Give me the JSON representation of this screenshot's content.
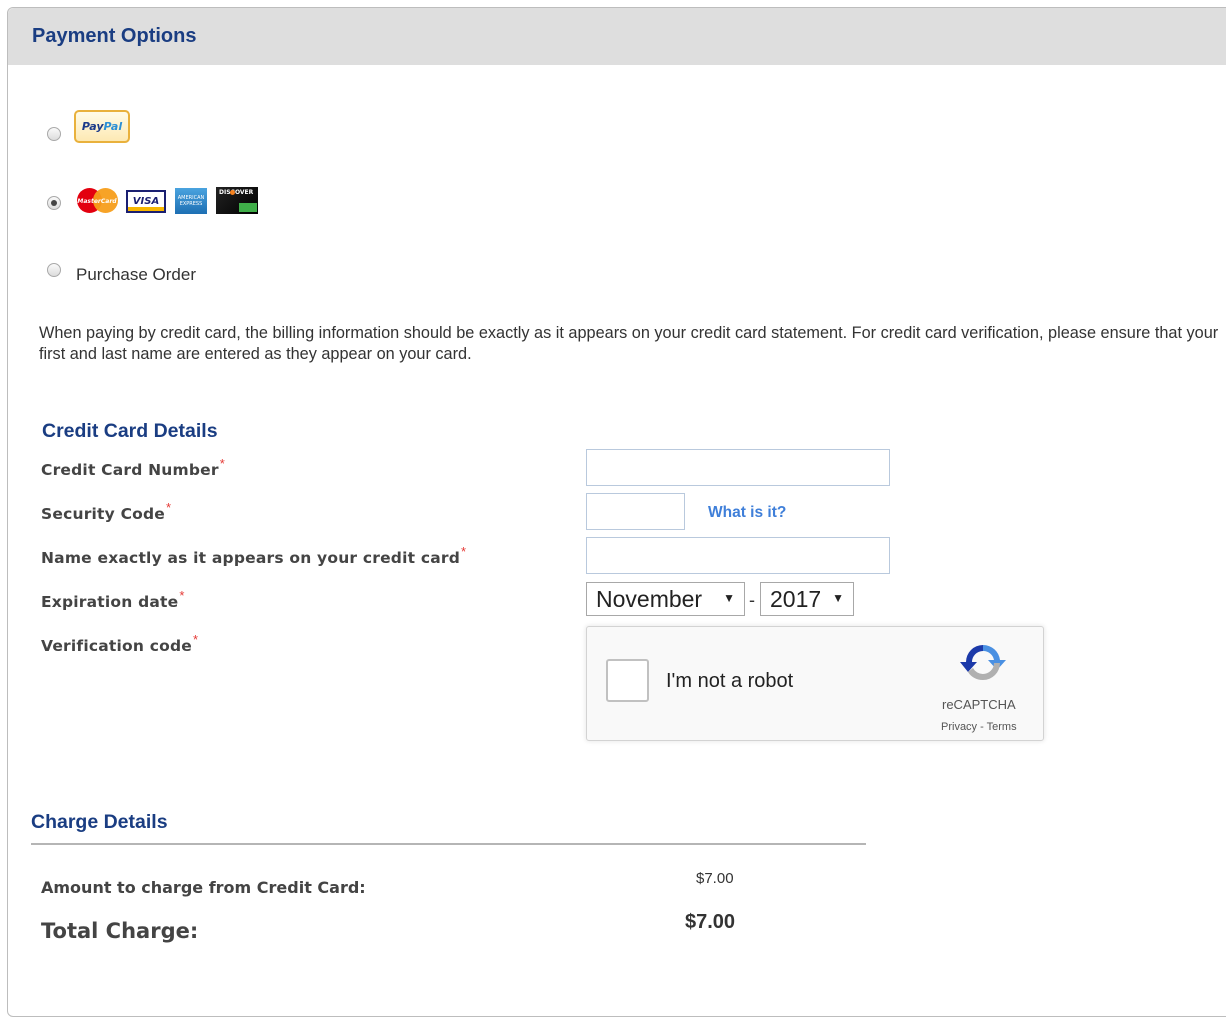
{
  "panel": {
    "title": "Payment Options"
  },
  "payment_options": [
    {
      "id": "paypal",
      "icon": "paypal-logo",
      "logo_text": [
        "Pay",
        "Pal"
      ],
      "selected": false
    },
    {
      "id": "credit_card",
      "icons": [
        "mastercard-logo",
        "visa-logo",
        "amex-logo",
        "discover-logo"
      ],
      "logo_text": {
        "mastercard": "MasterCard",
        "visa": "VISA",
        "amex": "AMERICAN EXPRESS",
        "discover": "DISCOVER"
      },
      "selected": true
    },
    {
      "id": "purchase_order",
      "label": "Purchase Order",
      "selected": false
    }
  ],
  "info_text": "When paying by credit card, the billing information should be exactly as it appears on your credit card statement. For credit card verification, please ensure that your first and last name are entered as they appear on your card.",
  "credit_card": {
    "title": "Credit Card Details",
    "number_label": "Credit Card Number",
    "security_label": "Security Code",
    "what_is_it": "What is it?",
    "name_label": "Name exactly as it appears on your credit card",
    "expiration_label": "Expiration date",
    "expiration_month": "November",
    "expiration_separator": "-",
    "expiration_year": "2017",
    "verification_label": "Verification code",
    "required_mark": "*",
    "number_value": "",
    "security_value": "",
    "name_value": ""
  },
  "recaptcha": {
    "label": "I'm not a robot",
    "brand": "reCAPTCHA",
    "privacy": "Privacy",
    "separator": " - ",
    "terms": "Terms",
    "checked": false
  },
  "charge": {
    "title": "Charge Details",
    "amount_label": "Amount to charge from Credit Card:",
    "amount_value": "$7.00",
    "total_label": "Total Charge:",
    "total_value": "$7.00"
  },
  "colors": {
    "accent": "#1a3d82",
    "link": "#3f7fd9",
    "required": "#e53935",
    "header_bg": "#dedede"
  }
}
